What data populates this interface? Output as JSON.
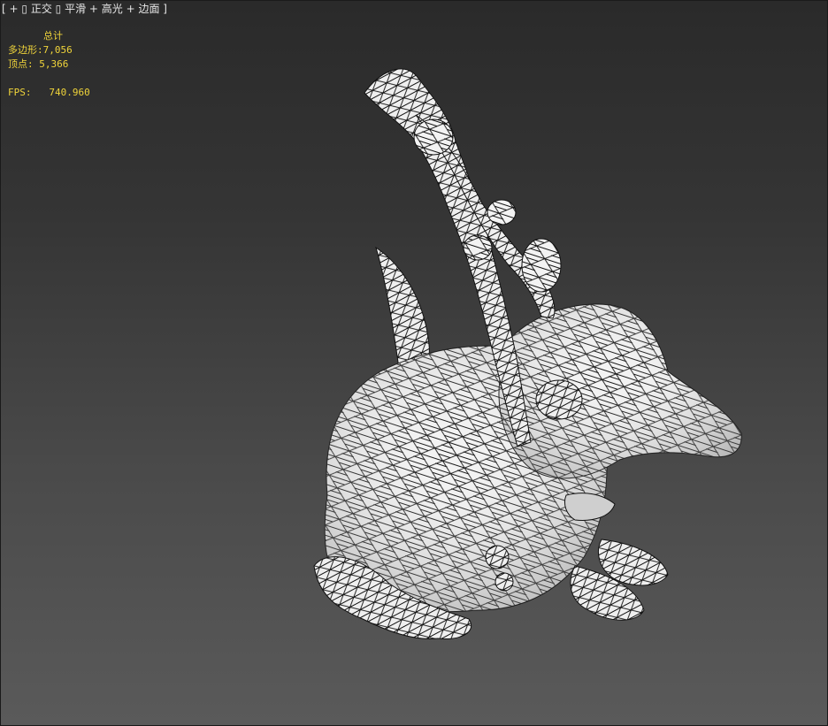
{
  "viewport": {
    "label": {
      "open_bracket": "[",
      "plus_menu": "+",
      "view_menu": "正交",
      "shading_menu": "平滑 + 高光 + 边面",
      "close_bracket": "]"
    },
    "stats": {
      "title": "总计",
      "polygons_label": "多边形:",
      "polygons_value": "7,056",
      "vertices_label": "顶点:",
      "vertices_value": "5,366",
      "fps_label": "FPS:",
      "fps_value": "740.960"
    },
    "colors": {
      "background_top": "#2a2a2a",
      "background_bottom": "#5a5a5a",
      "stats_text": "#f0d43a",
      "label_text": "#e6e6e6",
      "model_fill": "#f2f2f2",
      "wire": "#101010"
    },
    "model_name": "wireframe-creature"
  }
}
